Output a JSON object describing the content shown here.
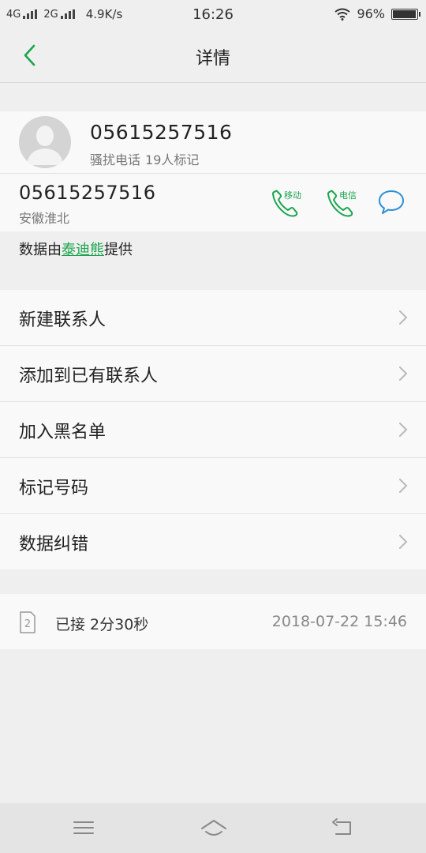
{
  "status_bar": {
    "net1": "4G",
    "net2": "2G",
    "speed": "4.9K/s",
    "time": "16:26",
    "battery": "96%",
    "battery_level": 0.96
  },
  "header": {
    "title": "详情"
  },
  "contact": {
    "number": "05615257516",
    "tag": "骚扰电话",
    "mark_count": "19人标记",
    "number_secondary": "05615257516",
    "location": "安徽淮北",
    "call_buttons": [
      {
        "label": "移动"
      },
      {
        "label": "电信"
      }
    ]
  },
  "provider": {
    "prefix": "数据由",
    "name": "泰迪熊",
    "suffix": "提供"
  },
  "menu": [
    {
      "label": "新建联系人"
    },
    {
      "label": "添加到已有联系人"
    },
    {
      "label": "加入黑名单"
    },
    {
      "label": "标记号码"
    },
    {
      "label": "数据纠错"
    }
  ],
  "call_log": {
    "sim": "2",
    "status": "已接 2分30秒",
    "datetime": "2018-07-22 15:46"
  },
  "colors": {
    "accent": "#1aa54d",
    "message": "#2e8fd8"
  }
}
